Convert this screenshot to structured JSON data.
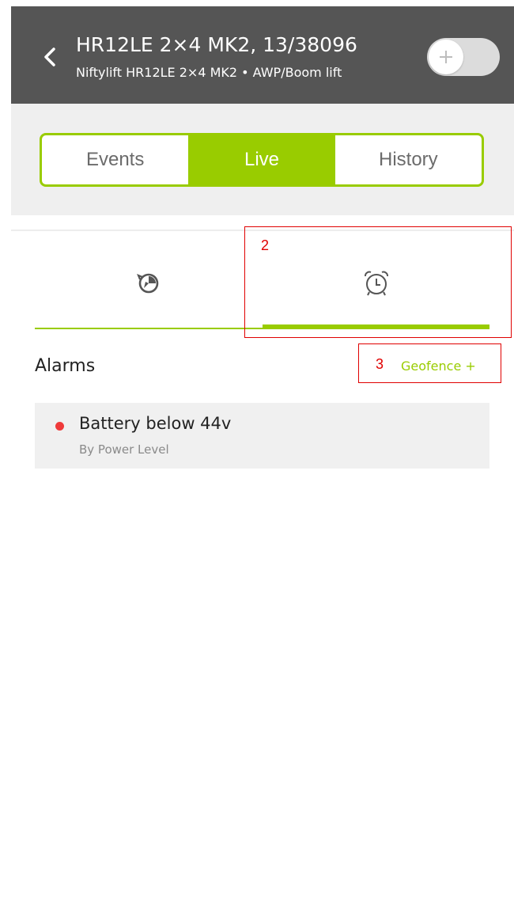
{
  "header": {
    "title": "HR12LE 2×4 MK2, 13/38096",
    "subtitle": "Niftylift HR12LE 2×4 MK2 • AWP/Boom lift",
    "back_icon": "chevron-left-icon",
    "toggle_icon": "plus-icon"
  },
  "tabs": [
    {
      "label": "Events",
      "active": false
    },
    {
      "label": "Live",
      "active": true
    },
    {
      "label": "History",
      "active": false
    }
  ],
  "subtabs": [
    {
      "icon": "tracking-icon",
      "active": false
    },
    {
      "icon": "alarm-clock-icon",
      "active": true
    }
  ],
  "annotations": {
    "box2": "2",
    "box3": "3"
  },
  "alarms": {
    "section_title": "Alarms",
    "geofence_link": "Geofence +",
    "items": [
      {
        "title": "Battery below 44v",
        "subtitle": "By Power Level",
        "status_color": "#ef3a3a"
      }
    ]
  },
  "colors": {
    "accent": "#99cc00",
    "header_bg": "#555555",
    "annotation": "#e00000"
  }
}
